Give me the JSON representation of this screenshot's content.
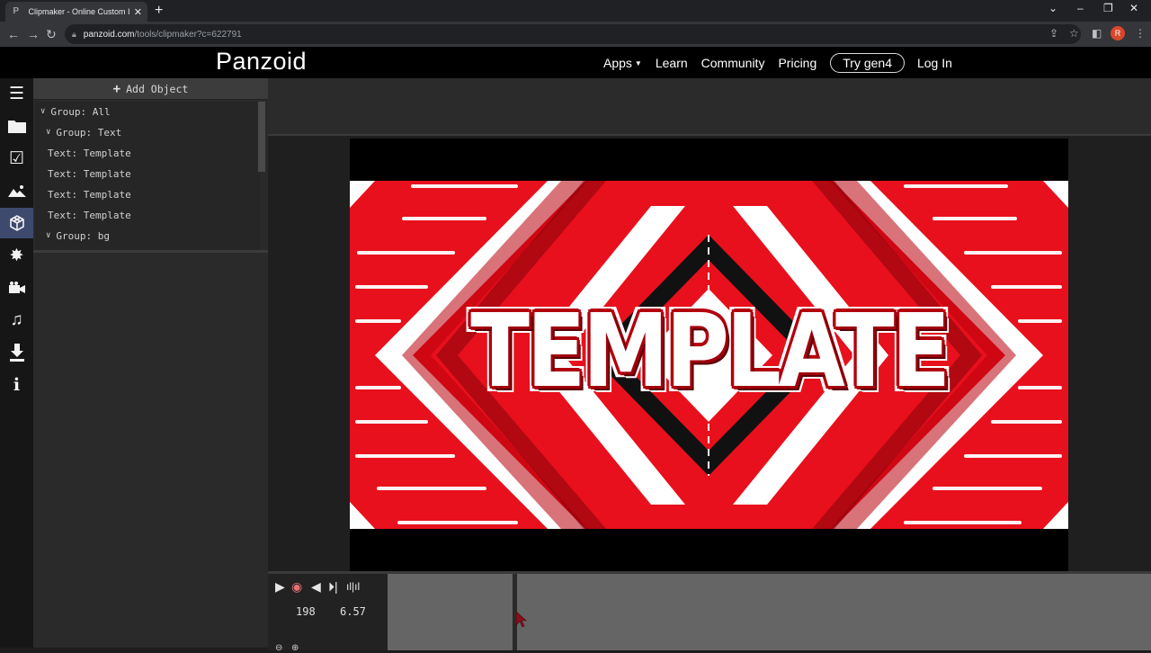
{
  "browser": {
    "tab_title": "Clipmaker - Online Custom Intro",
    "url_host": "panzoid.com",
    "url_path": "/tools/clipmaker?c=622791",
    "profile_initial": "R"
  },
  "site": {
    "logo": "Panzoid",
    "nav": {
      "apps": "Apps",
      "learn": "Learn",
      "community": "Community",
      "pricing": "Pricing",
      "try": "Try gen4",
      "login": "Log In"
    }
  },
  "sidebar_icons": [
    "menu-icon",
    "folder-icon",
    "checkbox-icon",
    "image-icon",
    "3d-cube-icon",
    "burst-icon",
    "camera-icon",
    "music-icon",
    "download-icon",
    "info-icon"
  ],
  "panel": {
    "add_object": "Add Object",
    "tree": [
      {
        "label": "Group: All",
        "caret": true
      },
      {
        "label": "Group: Text",
        "caret": true
      },
      {
        "label": "Text: Template",
        "caret": false
      },
      {
        "label": "Text: Template",
        "caret": false
      },
      {
        "label": "Text: Template",
        "caret": false
      },
      {
        "label": "Text: Template",
        "caret": false
      },
      {
        "label": "Group: bg",
        "caret": true
      }
    ]
  },
  "preview": {
    "title_text": "TEMPLATE",
    "colors": {
      "red": "#e8101c",
      "dark_red": "#8a0008",
      "white": "#ffffff",
      "black": "#000000"
    }
  },
  "timeline": {
    "frame": "198",
    "time": "6.57"
  }
}
